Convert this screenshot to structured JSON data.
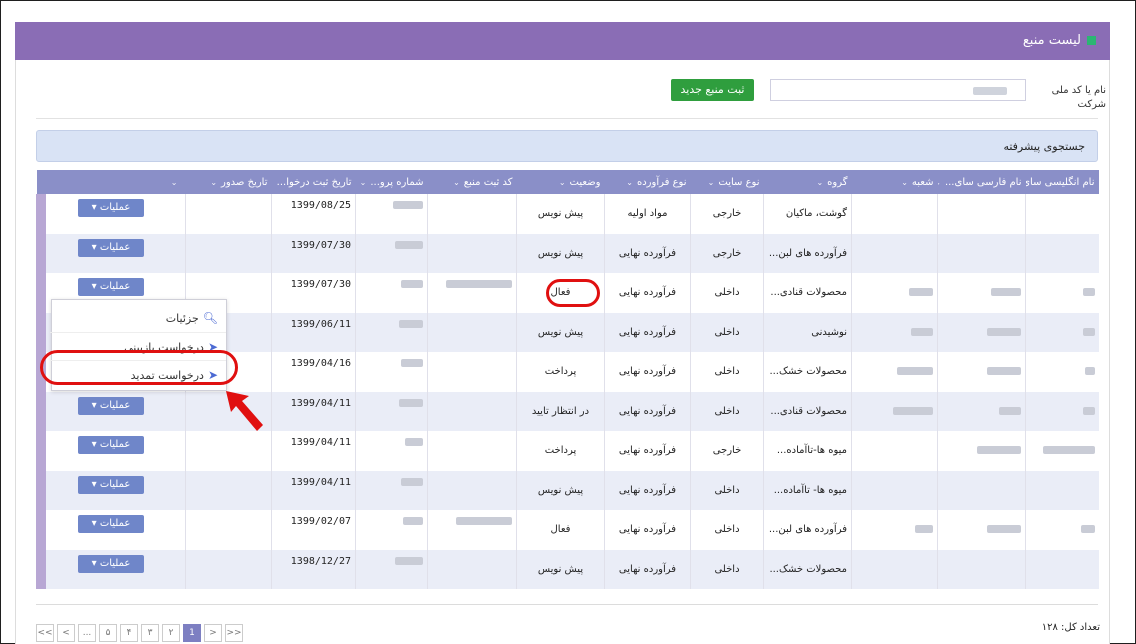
{
  "header": {
    "title": "لیست منبع"
  },
  "filters": {
    "company_label": "نام یا کد ملی شرکت",
    "new_button": "ثبت منبع جدید",
    "advanced_search": "جستجوی پیشرفته"
  },
  "table": {
    "columns": [
      "نام انگلیسی سای...",
      "نام فارسی سای...",
      "شعبه",
      "گروه",
      "نوع سایت",
      "نوع فرآورده",
      "وضعیت",
      "کد ثبت منبع",
      "شماره پرو...",
      "تاریخ ثبت درخوا...",
      "تاریخ صدور",
      ""
    ],
    "op_label": "عملیات",
    "rows": [
      {
        "group": "گوشت، ماکیان",
        "site": "خارجی",
        "product": "مواد اولیه",
        "status": "پیش نویس",
        "date": "1399/08/25"
      },
      {
        "group": "فرآورده های لبن...",
        "site": "خارجی",
        "product": "فرآورده نهایی",
        "status": "پیش نویس",
        "date": "1399/07/30"
      },
      {
        "group": "محصولات قنادی...",
        "site": "داخلی",
        "product": "فرآورده نهایی",
        "status": "فعال",
        "date": "1399/07/30"
      },
      {
        "group": "نوشیدنی",
        "site": "داخلی",
        "product": "فرآورده نهایی",
        "status": "پیش نویس",
        "date": "1399/06/11"
      },
      {
        "group": "محصولات خشک...",
        "site": "داخلی",
        "product": "فرآورده نهایی",
        "status": "پرداخت",
        "date": "1399/04/16"
      },
      {
        "group": "محصولات قنادی...",
        "site": "داخلی",
        "product": "فرآورده نهایی",
        "status": "در انتظار تایید",
        "date": "1399/04/11"
      },
      {
        "group": "میوه ها-تاآماده...",
        "site": "خارجی",
        "product": "فرآورده نهایی",
        "status": "پرداخت",
        "date": "1399/04/11"
      },
      {
        "group": "میوه ها- تاآماده...",
        "site": "داخلی",
        "product": "فرآورده نهایی",
        "status": "پیش نویس",
        "date": "1399/04/11"
      },
      {
        "group": "فرآورده های لبن...",
        "site": "داخلی",
        "product": "فرآورده نهایی",
        "status": "فعال",
        "date": "1399/02/07"
      },
      {
        "group": "محصولات خشک...",
        "site": "داخلی",
        "product": "فرآورده نهایی",
        "status": "پیش نویس",
        "date": "1398/12/27"
      }
    ]
  },
  "dropdown": {
    "details": "جزئیات",
    "inspection": "درخواست بازبینی",
    "renewal": "درخواست تمدید"
  },
  "footer": {
    "total": "تعداد کل: ۱۲۸",
    "pages": [
      "<<",
      "<",
      "...",
      "۵",
      "۴",
      "۳",
      "۲",
      "1",
      ">",
      ">>"
    ],
    "active_page": "1"
  },
  "colors": {
    "header": "#8a6db5",
    "accent": "#2f9e3e",
    "highlight": "#e01010"
  }
}
